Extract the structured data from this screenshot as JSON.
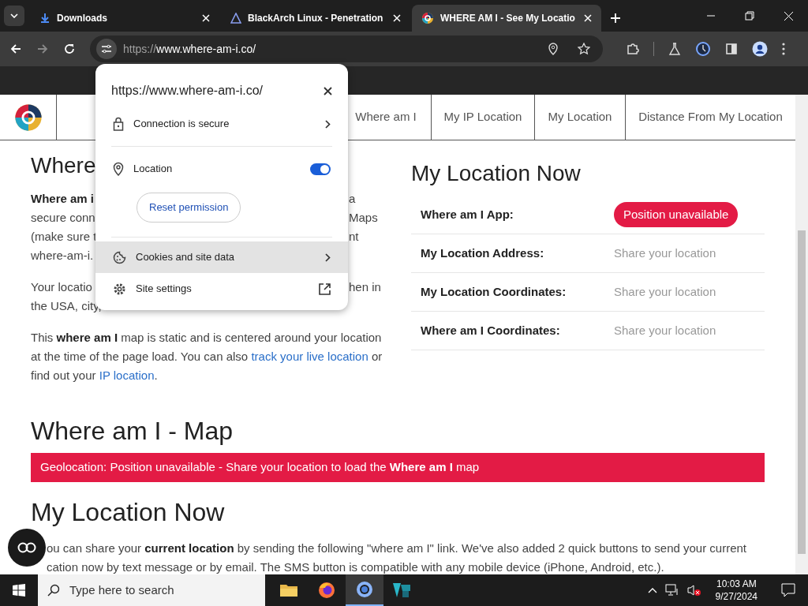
{
  "browser": {
    "tabs": [
      {
        "title": "Downloads",
        "selected": false
      },
      {
        "title": "BlackArch Linux - Penetration",
        "selected": false
      },
      {
        "title": "WHERE AM I - See My Locatio",
        "selected": true
      }
    ],
    "url_scheme": "https://",
    "url_host": "www.where-am-i.co/"
  },
  "site": {
    "nav": [
      "Where am I",
      "My IP Location",
      "My Location",
      "Distance From My Location"
    ],
    "intro_heading": "Where",
    "intro_lines": [
      {
        "left": "Where am i",
        "right": "a"
      },
      {
        "left": "secure conn",
        "right": "Maps"
      },
      {
        "left": "(make sure t",
        "right": "nt"
      },
      {
        "left": "where-am-i."
      }
    ],
    "para2_lines": [
      {
        "left": "Your locatio",
        "right": "hen in"
      },
      {
        "left": "the USA, city,"
      }
    ],
    "para3": [
      {
        "kind": "text",
        "text": "This **where am I** map is static and is centered around your location at the time of the page load. You can also "
      },
      {
        "kind": "link",
        "text": "track your live location"
      },
      {
        "kind": "text",
        "text": " or find out your "
      },
      {
        "kind": "link",
        "text": "IP location"
      },
      {
        "kind": "text",
        "text": "."
      }
    ],
    "now_heading": "My Location Now",
    "now_rows": [
      {
        "label": "Where am I App:",
        "value": "Position unavailable",
        "kind": "badge"
      },
      {
        "label": "My Location Address:",
        "value": "Share your location",
        "kind": "text"
      },
      {
        "label": "My Location Coordinates:",
        "value": "Share your location",
        "kind": "text"
      },
      {
        "label": "Where am I Coordinates:",
        "value": "Share your location",
        "kind": "text"
      }
    ],
    "map_heading": "Where am I - Map",
    "map_alert": "Geolocation: Position unavailable - Share your location to load the **Where am I** map",
    "share_heading": "My Location Now",
    "share_lines": [
      "ou can share your **current location** by sending the following \"where am I\" link. We've also added 2 quick buttons to send your current",
      "cation now by text message or by email. The SMS button is compatible with any mobile device (iPhone, Android, etc.)."
    ]
  },
  "popup": {
    "url": "https://www.where-am-i.co/",
    "rows": [
      {
        "kind": "link",
        "label": "Connection is secure",
        "highlighted": false
      },
      {
        "kind": "toggle",
        "label": "Location",
        "on": true,
        "highlighted": false
      },
      {
        "kind": "button",
        "label": "Reset permission",
        "highlighted": false
      },
      {
        "kind": "link",
        "label": "Cookies and site data",
        "highlighted": true
      },
      {
        "kind": "external",
        "label": "Site settings",
        "highlighted": false
      }
    ]
  },
  "taskbar": {
    "search_placeholder": "Type here to search",
    "apps": [
      {
        "selected": false
      },
      {
        "selected": false
      },
      {
        "selected": true
      },
      {
        "selected": false
      }
    ],
    "time": "10:03 AM",
    "date": "9/27/2024"
  }
}
